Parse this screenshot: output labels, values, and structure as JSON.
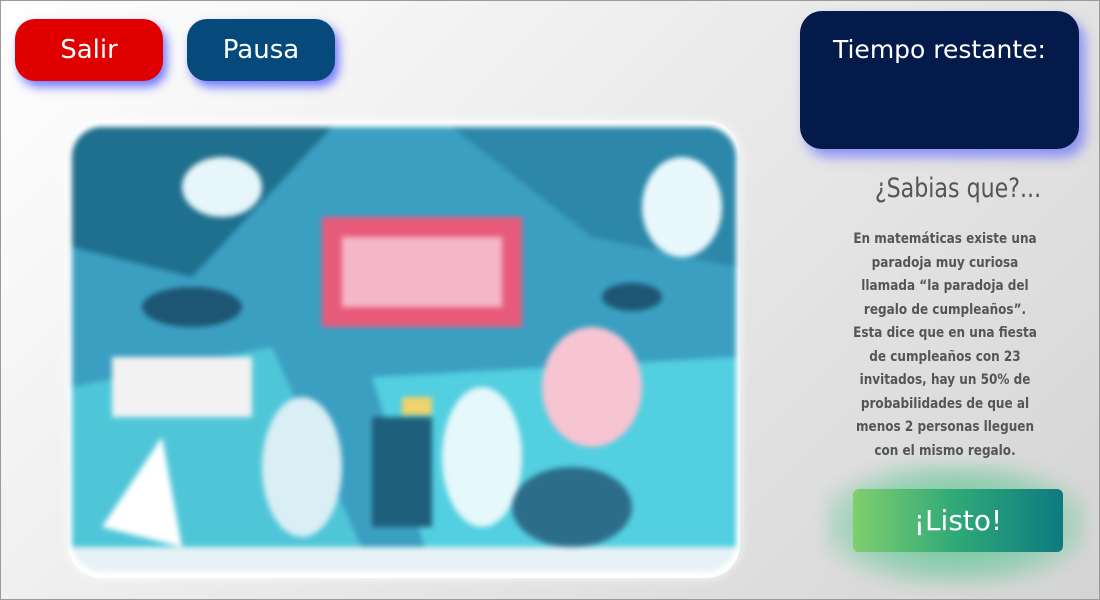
{
  "buttons": {
    "exit_label": "Salir",
    "pause_label": "Pausa",
    "ready_label": "¡Listo!"
  },
  "timer": {
    "label": "Tiempo restante:",
    "value": ""
  },
  "fact": {
    "title": "¿Sabias que?...",
    "body": "En matemáticas existe una paradoja muy curiosa llamada “la paradoja del regalo de cumpleaños”. Esta dice que en una fiesta de cumpleaños con 23 invitados, hay un 50% de probabilidades de que al menos 2 personas lleguen con el mismo regalo."
  },
  "puzzle": {
    "state": "blurred"
  },
  "colors": {
    "exit": "#e00000",
    "pause": "#064a7c",
    "timer_bg": "#041a4a",
    "ready_start": "#7fcf6e",
    "ready_end": "#0e7a80",
    "glow": "#5a5aff"
  }
}
